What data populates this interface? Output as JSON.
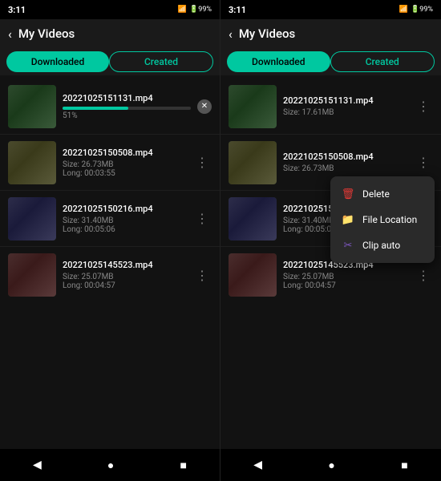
{
  "panel_left": {
    "status": {
      "time": "3:11",
      "icons": "● ■ ♦ 99%"
    },
    "header": {
      "back_label": "‹",
      "title": "My Videos"
    },
    "tabs": {
      "downloaded": "Downloaded",
      "created": "Created",
      "active": "downloaded"
    },
    "videos": [
      {
        "name": "20221025151131.mp4",
        "size": "",
        "duration": "",
        "downloading": true,
        "progress": 51,
        "progress_text": "51%",
        "thumb_class": "thumb-img"
      },
      {
        "name": "20221025150508.mp4",
        "size": "Size: 26.73MB",
        "duration": "Long: 00:03:55",
        "thumb_class": "thumb-img-2"
      },
      {
        "name": "20221025150216.mp4",
        "size": "Size: 31.40MB",
        "duration": "Long: 00:05:06",
        "thumb_class": "thumb-img-3"
      },
      {
        "name": "20221025145523.mp4",
        "size": "Size: 25.07MB",
        "duration": "Long: 00:04:57",
        "thumb_class": "thumb-img-4"
      }
    ],
    "nav": {
      "back": "◀",
      "home": "●",
      "square": "■"
    }
  },
  "panel_right": {
    "status": {
      "time": "3:11",
      "icons": "● ■ ♦ 99%"
    },
    "header": {
      "back_label": "‹",
      "title": "My Videos"
    },
    "tabs": {
      "downloaded": "Downloaded",
      "created": "Created",
      "active": "downloaded"
    },
    "videos": [
      {
        "name": "20221025151131.mp4",
        "size": "Size: 17.61MB",
        "duration": "",
        "thumb_class": "thumb-img"
      },
      {
        "name": "20221025150508.mp4",
        "size": "Size: 26.73MB",
        "duration": "",
        "thumb_class": "thumb-img-2",
        "menu_open": true
      },
      {
        "name": "20221025150216.mp4",
        "size": "Size: 31.40MB",
        "duration": "Long: 00:05:06",
        "thumb_class": "thumb-img-3"
      },
      {
        "name": "20221025145523.mp4",
        "size": "Size: 25.07MB",
        "duration": "Long: 00:04:57",
        "thumb_class": "thumb-img-4"
      }
    ],
    "context_menu": {
      "items": [
        {
          "id": "delete",
          "label": "Delete",
          "icon": "🗑",
          "icon_class": "icon-delete"
        },
        {
          "id": "file-location",
          "label": "File Location",
          "icon": "📁",
          "icon_class": "icon-file"
        },
        {
          "id": "clip-auto",
          "label": "Clip auto",
          "icon": "✂",
          "icon_class": "icon-clip"
        }
      ]
    },
    "nav": {
      "back": "◀",
      "home": "●",
      "square": "■"
    }
  }
}
